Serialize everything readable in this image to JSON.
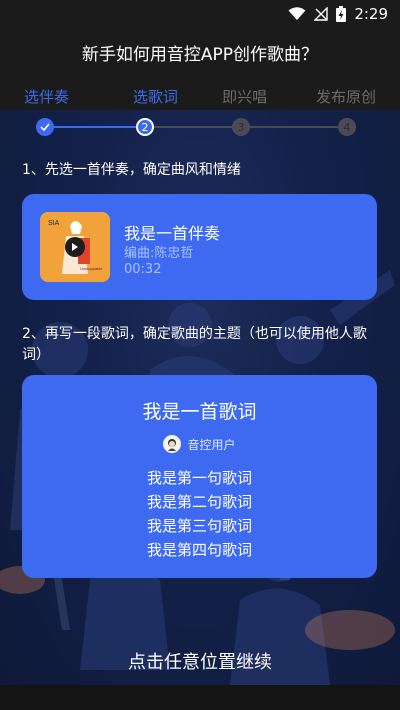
{
  "status": {
    "time": "2:29",
    "icons": [
      "wifi-icon",
      "no-signal-icon",
      "battery-charging-icon"
    ]
  },
  "header": {
    "title": "新手如何用音控APP创作歌曲？"
  },
  "tabs": [
    {
      "label": "选伴奏",
      "active": true
    },
    {
      "label": "选歌词",
      "active": true
    },
    {
      "label": "即兴唱",
      "active": false
    },
    {
      "label": "发布原创",
      "active": false
    }
  ],
  "steps": {
    "current": 2,
    "labels": [
      "✓",
      "2",
      "3",
      "4"
    ]
  },
  "section1": {
    "label": "1、先选一首伴奏，确定曲风和情绪"
  },
  "track": {
    "title": "我是一首伴奏",
    "composer": "编曲:陈忠哲",
    "duration": "00:32",
    "cover_text": "SIA",
    "cover_subtext": "Unstoppable"
  },
  "section2": {
    "label": "2、再写一段歌词，确定歌曲的主题（也可以使用他人歌词）"
  },
  "lyrics": {
    "title": "我是一首歌词",
    "author": "音控用户",
    "lines": [
      "我是第一句歌词",
      "我是第二句歌词",
      "我是第三句歌词",
      "我是第四句歌词"
    ]
  },
  "footer": {
    "hint": "点击任意位置继续"
  },
  "colors": {
    "accent": "#3d6af0",
    "tab_active": "#3b6cf0",
    "inactive": "#6b6b6b"
  }
}
